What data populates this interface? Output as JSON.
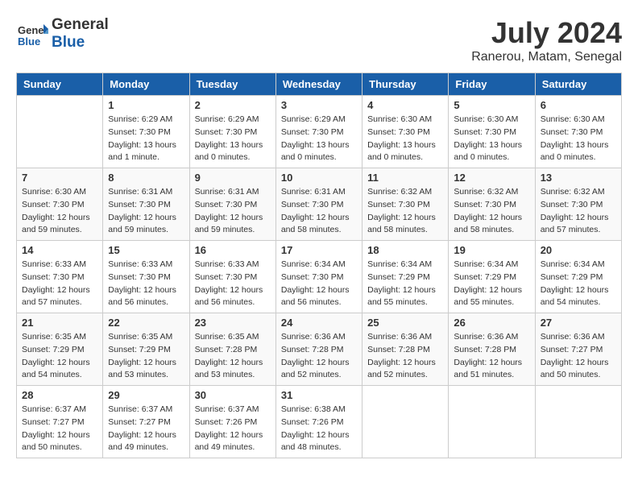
{
  "header": {
    "logo_line1": "General",
    "logo_line2": "Blue",
    "month_year": "July 2024",
    "location": "Ranerou, Matam, Senegal"
  },
  "columns": [
    "Sunday",
    "Monday",
    "Tuesday",
    "Wednesday",
    "Thursday",
    "Friday",
    "Saturday"
  ],
  "weeks": [
    [
      {
        "day": "",
        "info": ""
      },
      {
        "day": "1",
        "info": "Sunrise: 6:29 AM\nSunset: 7:30 PM\nDaylight: 13 hours\nand 1 minute."
      },
      {
        "day": "2",
        "info": "Sunrise: 6:29 AM\nSunset: 7:30 PM\nDaylight: 13 hours\nand 0 minutes."
      },
      {
        "day": "3",
        "info": "Sunrise: 6:29 AM\nSunset: 7:30 PM\nDaylight: 13 hours\nand 0 minutes."
      },
      {
        "day": "4",
        "info": "Sunrise: 6:30 AM\nSunset: 7:30 PM\nDaylight: 13 hours\nand 0 minutes."
      },
      {
        "day": "5",
        "info": "Sunrise: 6:30 AM\nSunset: 7:30 PM\nDaylight: 13 hours\nand 0 minutes."
      },
      {
        "day": "6",
        "info": "Sunrise: 6:30 AM\nSunset: 7:30 PM\nDaylight: 13 hours\nand 0 minutes."
      }
    ],
    [
      {
        "day": "7",
        "info": "Sunrise: 6:30 AM\nSunset: 7:30 PM\nDaylight: 12 hours\nand 59 minutes."
      },
      {
        "day": "8",
        "info": "Sunrise: 6:31 AM\nSunset: 7:30 PM\nDaylight: 12 hours\nand 59 minutes."
      },
      {
        "day": "9",
        "info": "Sunrise: 6:31 AM\nSunset: 7:30 PM\nDaylight: 12 hours\nand 59 minutes."
      },
      {
        "day": "10",
        "info": "Sunrise: 6:31 AM\nSunset: 7:30 PM\nDaylight: 12 hours\nand 58 minutes."
      },
      {
        "day": "11",
        "info": "Sunrise: 6:32 AM\nSunset: 7:30 PM\nDaylight: 12 hours\nand 58 minutes."
      },
      {
        "day": "12",
        "info": "Sunrise: 6:32 AM\nSunset: 7:30 PM\nDaylight: 12 hours\nand 58 minutes."
      },
      {
        "day": "13",
        "info": "Sunrise: 6:32 AM\nSunset: 7:30 PM\nDaylight: 12 hours\nand 57 minutes."
      }
    ],
    [
      {
        "day": "14",
        "info": "Sunrise: 6:33 AM\nSunset: 7:30 PM\nDaylight: 12 hours\nand 57 minutes."
      },
      {
        "day": "15",
        "info": "Sunrise: 6:33 AM\nSunset: 7:30 PM\nDaylight: 12 hours\nand 56 minutes."
      },
      {
        "day": "16",
        "info": "Sunrise: 6:33 AM\nSunset: 7:30 PM\nDaylight: 12 hours\nand 56 minutes."
      },
      {
        "day": "17",
        "info": "Sunrise: 6:34 AM\nSunset: 7:30 PM\nDaylight: 12 hours\nand 56 minutes."
      },
      {
        "day": "18",
        "info": "Sunrise: 6:34 AM\nSunset: 7:29 PM\nDaylight: 12 hours\nand 55 minutes."
      },
      {
        "day": "19",
        "info": "Sunrise: 6:34 AM\nSunset: 7:29 PM\nDaylight: 12 hours\nand 55 minutes."
      },
      {
        "day": "20",
        "info": "Sunrise: 6:34 AM\nSunset: 7:29 PM\nDaylight: 12 hours\nand 54 minutes."
      }
    ],
    [
      {
        "day": "21",
        "info": "Sunrise: 6:35 AM\nSunset: 7:29 PM\nDaylight: 12 hours\nand 54 minutes."
      },
      {
        "day": "22",
        "info": "Sunrise: 6:35 AM\nSunset: 7:29 PM\nDaylight: 12 hours\nand 53 minutes."
      },
      {
        "day": "23",
        "info": "Sunrise: 6:35 AM\nSunset: 7:28 PM\nDaylight: 12 hours\nand 53 minutes."
      },
      {
        "day": "24",
        "info": "Sunrise: 6:36 AM\nSunset: 7:28 PM\nDaylight: 12 hours\nand 52 minutes."
      },
      {
        "day": "25",
        "info": "Sunrise: 6:36 AM\nSunset: 7:28 PM\nDaylight: 12 hours\nand 52 minutes."
      },
      {
        "day": "26",
        "info": "Sunrise: 6:36 AM\nSunset: 7:28 PM\nDaylight: 12 hours\nand 51 minutes."
      },
      {
        "day": "27",
        "info": "Sunrise: 6:36 AM\nSunset: 7:27 PM\nDaylight: 12 hours\nand 50 minutes."
      }
    ],
    [
      {
        "day": "28",
        "info": "Sunrise: 6:37 AM\nSunset: 7:27 PM\nDaylight: 12 hours\nand 50 minutes."
      },
      {
        "day": "29",
        "info": "Sunrise: 6:37 AM\nSunset: 7:27 PM\nDaylight: 12 hours\nand 49 minutes."
      },
      {
        "day": "30",
        "info": "Sunrise: 6:37 AM\nSunset: 7:26 PM\nDaylight: 12 hours\nand 49 minutes."
      },
      {
        "day": "31",
        "info": "Sunrise: 6:38 AM\nSunset: 7:26 PM\nDaylight: 12 hours\nand 48 minutes."
      },
      {
        "day": "",
        "info": ""
      },
      {
        "day": "",
        "info": ""
      },
      {
        "day": "",
        "info": ""
      }
    ]
  ]
}
